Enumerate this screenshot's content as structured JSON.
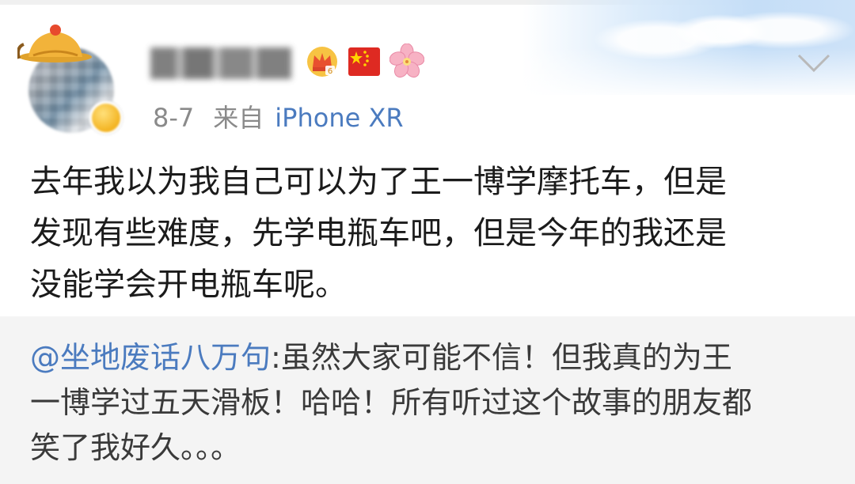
{
  "post": {
    "date": "8-7",
    "source_prefix": "来自",
    "device": "iPhone XR",
    "text_lines": [
      "去年我以为我自己可以为了王一博学摩托车，但是",
      "发现有些难度，先学电瓶车吧，但是今年的我还是",
      "没能学会开电瓶车呢。"
    ]
  },
  "repost": {
    "mention": "@坐地废话八万句",
    "text_lines": [
      ":虽然大家可能不信！但我真的为王",
      "一博学过五天滑板！哈哈！所有听过这个故事的朋友都",
      "笑了我好久。。。"
    ]
  },
  "icons": {
    "avatar_hat": "festive-hat-icon",
    "verified": "verified-badge-icon",
    "vip": "vip-crown-badge-icon",
    "flag": "china-flag-icon",
    "flower": "peach-blossom-icon",
    "more": "chevron-down-icon"
  },
  "colors": {
    "link": "#4b7bbf",
    "meta": "#8a8a8a",
    "text": "#1b1b1b",
    "repost_bg": "#f4f4f4"
  }
}
